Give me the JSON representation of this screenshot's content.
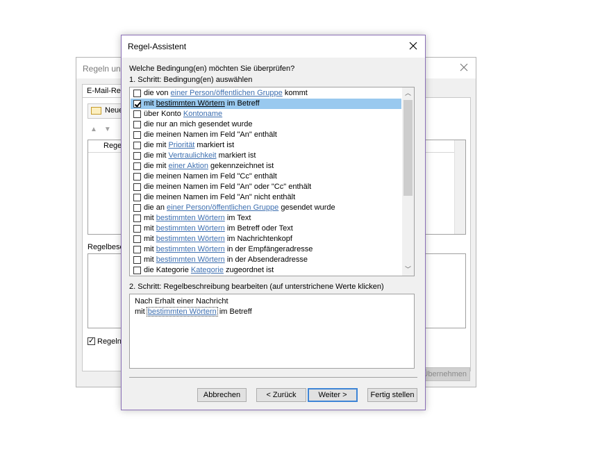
{
  "background_dialog": {
    "title": "Regeln und Benachrichtigungen",
    "tab": "E-Mail-Regeln",
    "new_button": "Neue Regel",
    "list_header": "Regel",
    "desc_label": "Regelbeschreibung",
    "checkbox_label": "Regeln",
    "apply_button": "Übernehmen"
  },
  "wizard": {
    "title": "Regel-Assistent",
    "question": "Welche Bedingung(en) möchten Sie überprüfen?",
    "step1": "1. Schritt: Bedingung(en) auswählen",
    "conditions": [
      {
        "pre": "die von ",
        "link": "einer Person/öffentlichen Gruppe",
        "post": " kommt",
        "checked": false,
        "selected": false
      },
      {
        "pre": "mit ",
        "link": "bestimmten Wörtern",
        "post": " im Betreff",
        "checked": true,
        "selected": true
      },
      {
        "pre": "über Konto ",
        "link": "Kontoname",
        "post": "",
        "checked": false,
        "selected": false
      },
      {
        "pre": "die nur an mich gesendet wurde",
        "link": "",
        "post": "",
        "checked": false,
        "selected": false
      },
      {
        "pre": "die meinen Namen im Feld \"An\" enthält",
        "link": "",
        "post": "",
        "checked": false,
        "selected": false
      },
      {
        "pre": "die mit ",
        "link": "Priorität",
        "post": " markiert ist",
        "checked": false,
        "selected": false
      },
      {
        "pre": "die mit ",
        "link": "Vertraulichkeit",
        "post": " markiert ist",
        "checked": false,
        "selected": false
      },
      {
        "pre": "die mit ",
        "link": "einer Aktion",
        "post": " gekennzeichnet ist",
        "checked": false,
        "selected": false
      },
      {
        "pre": "die meinen Namen im Feld \"Cc\" enthält",
        "link": "",
        "post": "",
        "checked": false,
        "selected": false
      },
      {
        "pre": "die meinen Namen im Feld \"An\" oder \"Cc\" enthält",
        "link": "",
        "post": "",
        "checked": false,
        "selected": false
      },
      {
        "pre": "die meinen Namen im Feld \"An\" nicht enthält",
        "link": "",
        "post": "",
        "checked": false,
        "selected": false
      },
      {
        "pre": "die an ",
        "link": "einer Person/öffentlichen Gruppe",
        "post": " gesendet wurde",
        "checked": false,
        "selected": false
      },
      {
        "pre": "mit ",
        "link": "bestimmten Wörtern",
        "post": " im Text",
        "checked": false,
        "selected": false
      },
      {
        "pre": "mit ",
        "link": "bestimmten Wörtern",
        "post": " im Betreff oder Text",
        "checked": false,
        "selected": false
      },
      {
        "pre": "mit ",
        "link": "bestimmten Wörtern",
        "post": " im Nachrichtenkopf",
        "checked": false,
        "selected": false
      },
      {
        "pre": "mit ",
        "link": "bestimmten Wörtern",
        "post": " in der Empfängeradresse",
        "checked": false,
        "selected": false
      },
      {
        "pre": "mit ",
        "link": "bestimmten Wörtern",
        "post": " in der Absenderadresse",
        "checked": false,
        "selected": false
      },
      {
        "pre": "die Kategorie ",
        "link": "Kategorie",
        "post": " zugeordnet ist",
        "checked": false,
        "selected": false
      }
    ],
    "step2": "2. Schritt: Regelbeschreibung bearbeiten (auf unterstrichene Werte klicken)",
    "description": {
      "line1": "Nach Erhalt einer Nachricht",
      "line2_pre": "mit ",
      "line2_link": "bestimmten Wörtern",
      "line2_post": " im Betreff"
    },
    "buttons": {
      "cancel": "Abbrechen",
      "back": "< Zurück",
      "next": "Weiter >",
      "finish": "Fertig stellen"
    }
  },
  "colors": {
    "selection": "#99c9ef",
    "link": "#3d6fb0",
    "wizard_border": "#8a6fb6",
    "default_button_border": "#3d84d6"
  }
}
